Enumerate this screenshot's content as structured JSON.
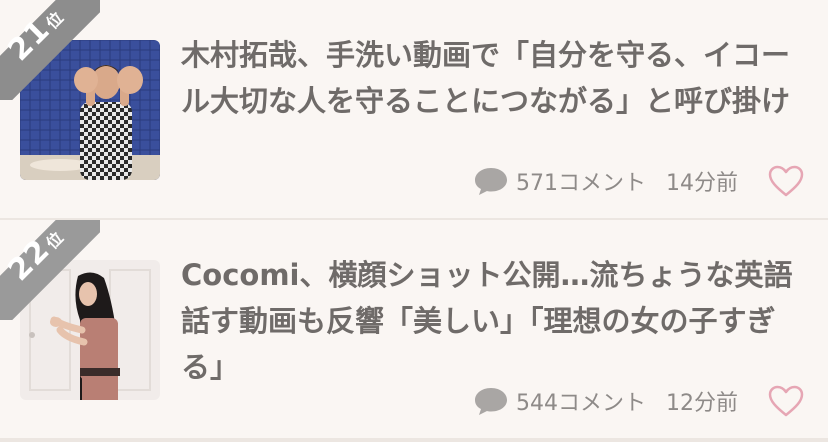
{
  "articles": [
    {
      "rank_number": "21",
      "rank_suffix": "位",
      "headline": "木村拓哉、手洗い動画で「自分を守る、イコール大切な人を守ることにつながる」と呼び掛け",
      "comments": "571コメント",
      "time": "14分前"
    },
    {
      "rank_number": "22",
      "rank_suffix": "位",
      "headline": "Cocomi、横顔ショット公開…流ちょうな英語話す動画も反響「美しい」「理想の女の子すぎる」",
      "comments": "544コメント",
      "time": "12分前"
    }
  ],
  "colors": {
    "ribbon": "#8d8d8d",
    "headline": "#6f6b69",
    "meta": "#8e8a88",
    "heart": "#e6a6b4",
    "comment_icon": "#a9a6a4"
  },
  "icons": {
    "comment": "speech-bubble-icon",
    "like": "heart-outline-icon"
  }
}
